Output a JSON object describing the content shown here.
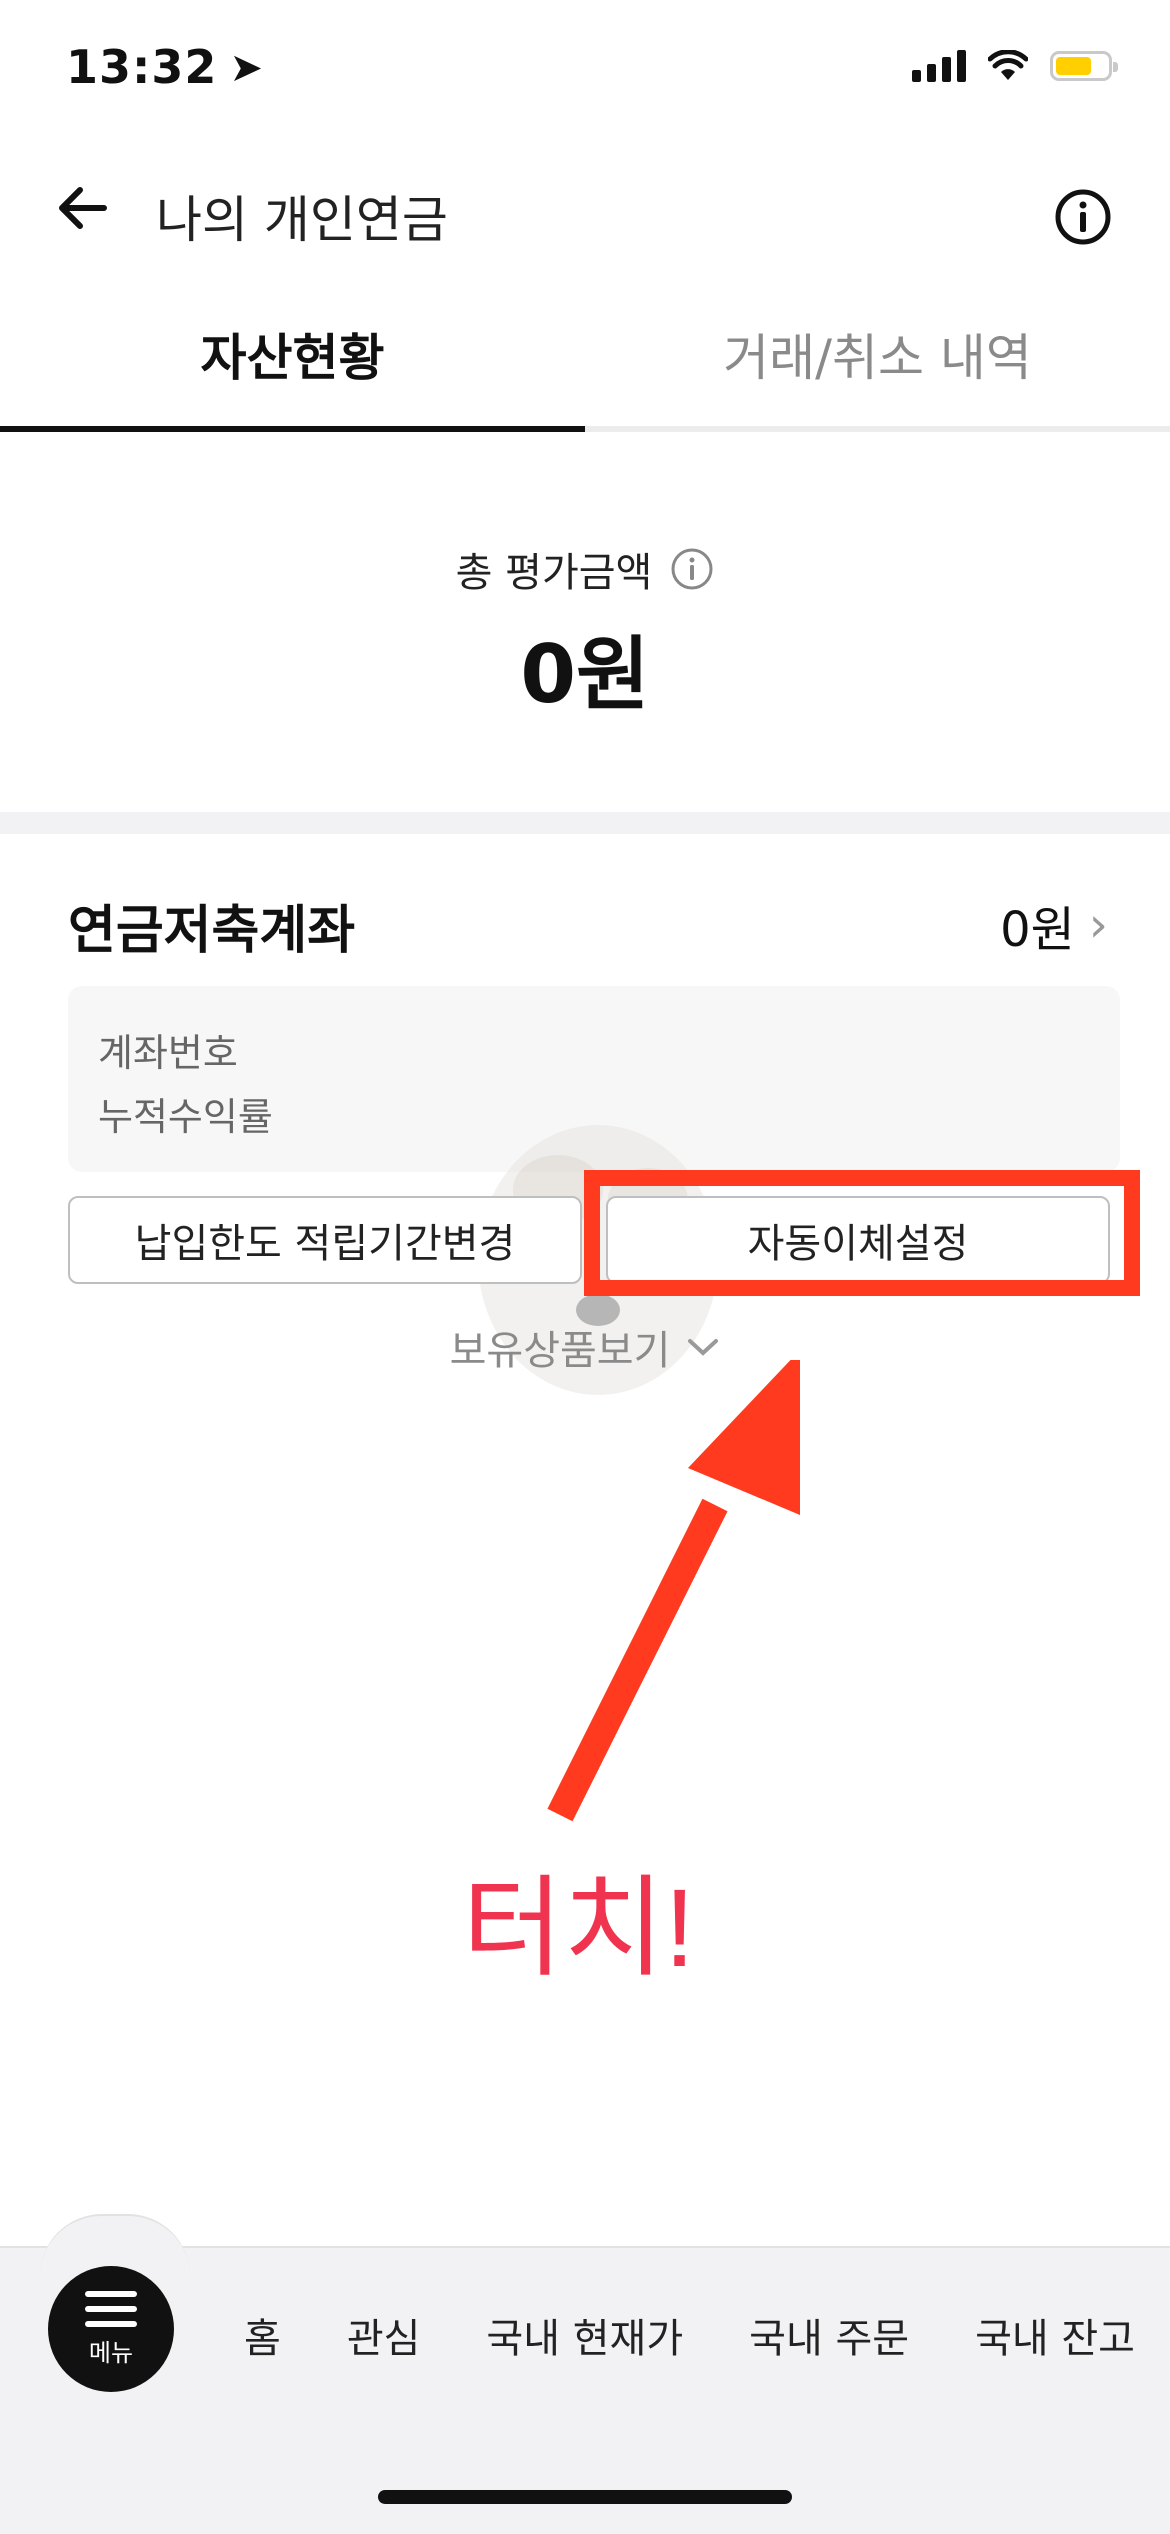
{
  "status_bar": {
    "time": "13:32"
  },
  "header": {
    "title": "나의 개인연금"
  },
  "tabs": [
    {
      "label": "자산현황",
      "active": true
    },
    {
      "label": "거래/취소 내역",
      "active": false
    }
  ],
  "summary": {
    "label": "총 평가금액",
    "value": "0원"
  },
  "account": {
    "title": "연금저축계좌",
    "value": "0원",
    "fields": [
      "계좌번호",
      "누적수익률"
    ]
  },
  "buttons": {
    "limit_change": "납입한도 적립기간변경",
    "auto_transfer": "자동이체설정"
  },
  "holdings_toggle": "보유상품보기",
  "annotation": {
    "text": "터치!",
    "color": "#f0334f",
    "highlight_color": "#ff3a1e"
  },
  "bottom_nav": {
    "menu_label": "메뉴",
    "items": [
      "홈",
      "관심",
      "국내 현재가",
      "국내 주문",
      "국내 잔고"
    ]
  }
}
